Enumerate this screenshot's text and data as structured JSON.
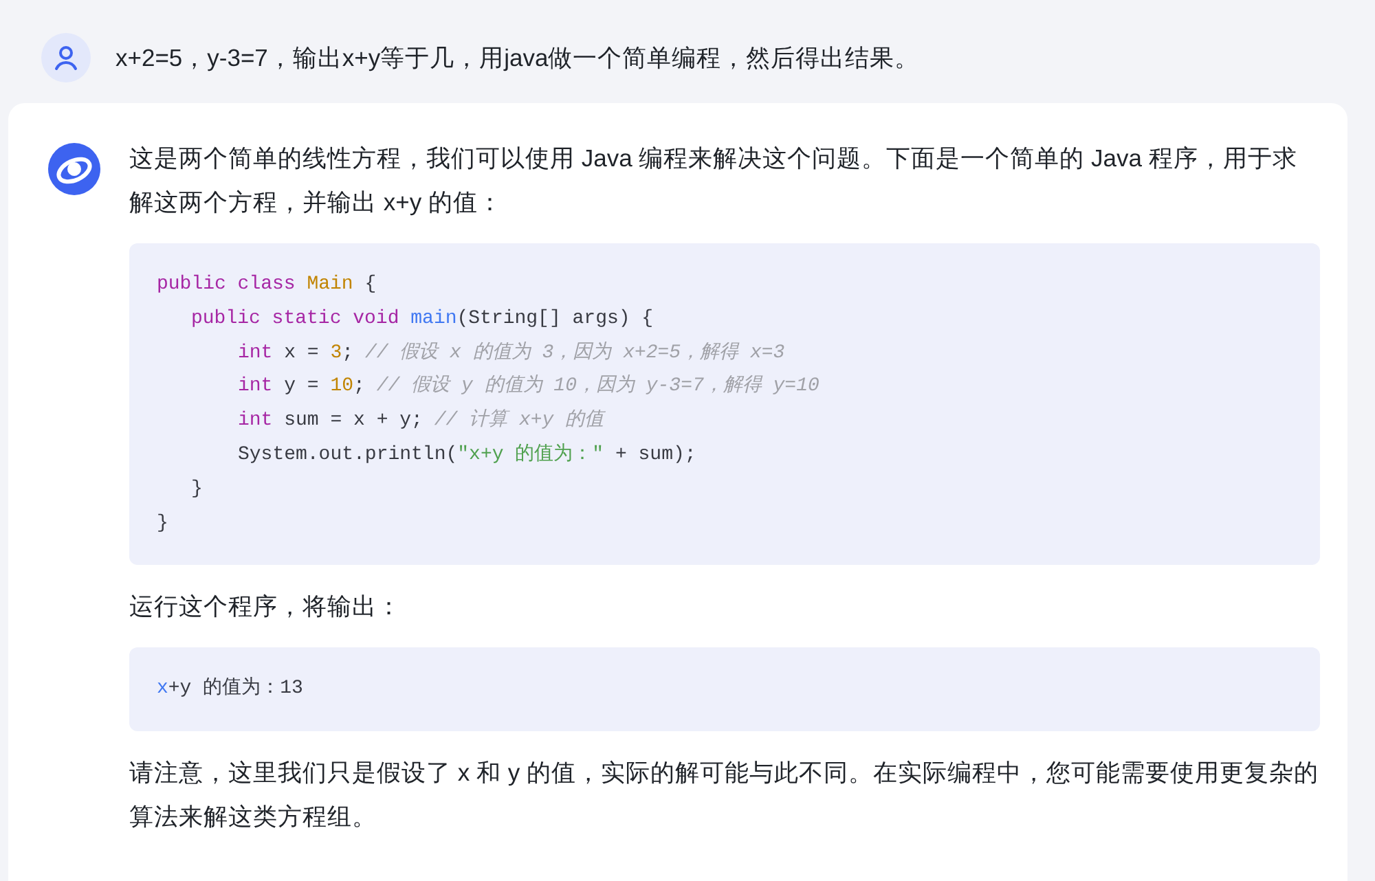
{
  "user_message": {
    "text": "x+2=5，y-3=7，输出x+y等于几，用java做一个简单编程，然后得出结果。"
  },
  "reply": {
    "blocks": [
      {
        "kind": "paragraph",
        "text": "这是两个简单的线性方程，我们可以使用 Java 编程来解决这个问题。下面是一个简单的 Java 程序，用于求解这两个方程，并输出 x+y 的值："
      },
      {
        "kind": "code",
        "lines": [
          {
            "tokens": [
              {
                "kind": "keyword",
                "text": "public class "
              },
              {
                "kind": "type",
                "text": "Main"
              },
              {
                "kind": "plain",
                "text": " {"
              }
            ],
            "children": [
              {
                "tokens": [
                  {
                    "kind": "keyword",
                    "text": "public static void "
                  },
                  {
                    "kind": "function",
                    "text": "main"
                  },
                  {
                    "kind": "plain",
                    "text": "(String[] args) {"
                  }
                ],
                "children": [
                  {
                    "tokens": [
                      {
                        "kind": "keyword",
                        "text": "int"
                      },
                      {
                        "kind": "plain",
                        "text": " x = "
                      },
                      {
                        "kind": "number",
                        "text": "3"
                      },
                      {
                        "kind": "plain",
                        "text": "; "
                      },
                      {
                        "kind": "comment",
                        "text": "// 假设 x 的值为 3，因为 x+2=5，解得 x=3"
                      }
                    ]
                  },
                  {
                    "tokens": [
                      {
                        "kind": "keyword",
                        "text": "int"
                      },
                      {
                        "kind": "plain",
                        "text": " y = "
                      },
                      {
                        "kind": "number",
                        "text": "10"
                      },
                      {
                        "kind": "plain",
                        "text": "; "
                      },
                      {
                        "kind": "comment",
                        "text": "// 假设 y 的值为 10，因为 y-3=7，解得 y=10"
                      }
                    ]
                  },
                  {
                    "tokens": [
                      {
                        "kind": "keyword",
                        "text": "int"
                      },
                      {
                        "kind": "plain",
                        "text": " sum = x + y; "
                      },
                      {
                        "kind": "comment",
                        "text": "// 计算 x+y 的值"
                      }
                    ]
                  },
                  {
                    "tokens": [
                      {
                        "kind": "plain",
                        "text": "System.out.println("
                      },
                      {
                        "kind": "string",
                        "text": "\"x+y 的值为：\""
                      },
                      {
                        "kind": "plain",
                        "text": " + sum);"
                      }
                    ]
                  }
                ]
              },
              {
                "tokens": [
                  {
                    "kind": "plain",
                    "text": "}"
                  }
                ]
              }
            ]
          },
          {
            "tokens": [
              {
                "kind": "plain",
                "text": "}"
              }
            ]
          }
        ]
      },
      {
        "kind": "paragraph",
        "text": "运行这个程序，将输出："
      },
      {
        "kind": "code",
        "lines": [
          {
            "tokens": [
              {
                "kind": "function",
                "text": "x"
              },
              {
                "kind": "plain",
                "text": "+y 的值为：13"
              }
            ]
          }
        ]
      },
      {
        "kind": "paragraph",
        "text": "请注意，这里我们只是假设了 x 和 y 的值，实际的解可能与此不同。在实际编程中，您可能需要使用更复杂的算法来解这类方程组。"
      }
    ]
  }
}
